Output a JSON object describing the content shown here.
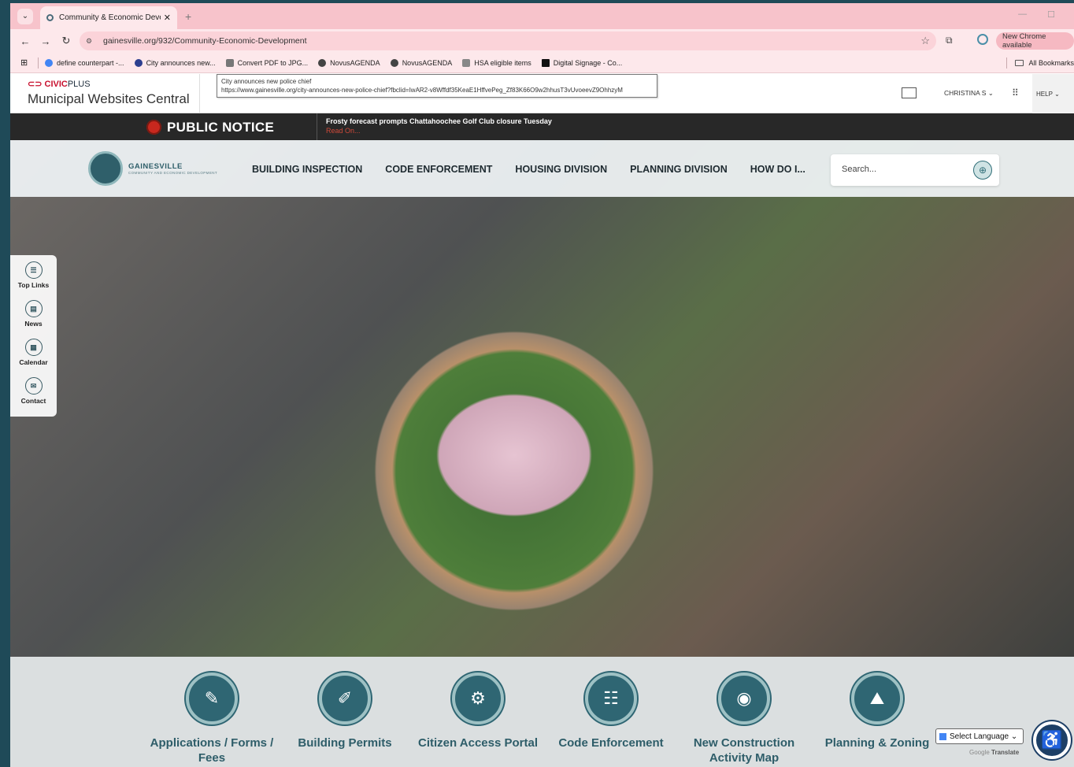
{
  "browser": {
    "tab_title": "Community & Economic Devel…",
    "new_tab_symbol": "+",
    "url": "gainesville.org/932/Community-Economic-Development",
    "update_label": "New Chrome available",
    "bookmarks": [
      {
        "label": "define counterpart -...",
        "icon": "google-icon"
      },
      {
        "label": "City announces new...",
        "icon": "star-logo-icon"
      },
      {
        "label": "Convert PDF to JPG...",
        "icon": "pdf-icon"
      },
      {
        "label": "NovusAGENDA",
        "icon": "globe-icon"
      },
      {
        "label": "NovusAGENDA",
        "icon": "globe-icon"
      },
      {
        "label": "HSA eligible items",
        "icon": "home-icon"
      },
      {
        "label": "Digital Signage - Co...",
        "icon": "signage-icon"
      }
    ],
    "all_bookmarks": "All Bookmarks",
    "tooltip": {
      "title": "City announces new police chief",
      "url": "https://www.gainesville.org/city-announces-new-police-chief?fbclid=IwAR2-v8Wffdf35KeaE1HffvePeg_Zf83K66O9w2hhusT3vUvoeevZ9OhhzyM"
    }
  },
  "civicplus": {
    "brand": "CIVIC",
    "brand_suffix": "PLUS",
    "subtitle": "Municipal Websites Central",
    "user": "CHRISTINA S",
    "help": "HELP"
  },
  "notice": {
    "label": "PUBLIC NOTICE",
    "headline": "Frosty forecast prompts Chattahoochee Golf Club closure Tuesday",
    "read_on": "Read On..."
  },
  "site": {
    "logo_name": "GAINESVILLE",
    "logo_sub": "COMMUNITY AND ECONOMIC DEVELOPMENT",
    "menu": [
      "BUILDING INSPECTION",
      "CODE ENFORCEMENT",
      "HOUSING DIVISION",
      "PLANNING DIVISION",
      "HOW DO I..."
    ],
    "search_placeholder": "Search...",
    "side_links": [
      "Top Links",
      "News",
      "Calendar",
      "Contact"
    ],
    "quick_links": [
      {
        "label": "Applications / Forms / Fees",
        "icon": "form-edit-icon"
      },
      {
        "label": "Building Permits",
        "icon": "permit-icon"
      },
      {
        "label": "Citizen Access Portal",
        "icon": "gear-icon"
      },
      {
        "label": "Code Enforcement",
        "icon": "clipboard-icon"
      },
      {
        "label": "New Construction Activity Map",
        "icon": "map-pin-icon"
      },
      {
        "label": "Planning & Zoning",
        "icon": "zoning-icon"
      }
    ],
    "language": "Select Language",
    "translate_prefix": "Google",
    "translate": "Translate"
  }
}
